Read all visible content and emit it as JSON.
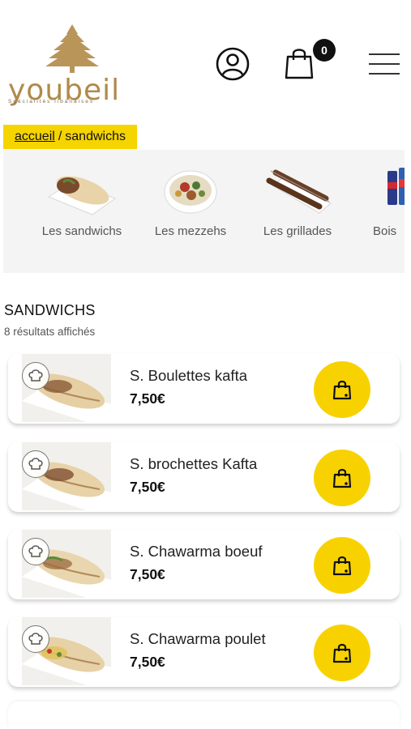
{
  "header": {
    "logo_word": "youbeil",
    "logo_tagline": "Spécialités libanaises",
    "cart_count": "0",
    "icons": {
      "account": "user-icon",
      "cart": "shopping-bag-icon",
      "menu": "hamburger-menu-icon"
    }
  },
  "breadcrumb": {
    "home": "accueil",
    "separator": "/",
    "current": "sandwichs"
  },
  "categories": [
    {
      "label": "Les sandwichs",
      "icon": "sandwich-image"
    },
    {
      "label": "Les mezzehs",
      "icon": "mezze-bowl-image"
    },
    {
      "label": "Les grillades",
      "icon": "skewers-image"
    },
    {
      "label": "Bois",
      "icon": "drinks-cans-image"
    }
  ],
  "section": {
    "title": "SANDWICHS",
    "results": "8 résultats affichés"
  },
  "products": [
    {
      "name": "S. Boulettes kafta",
      "price": "7,50€"
    },
    {
      "name": "S. brochettes Kafta",
      "price": "7,50€"
    },
    {
      "name": "S. Chawarma boeuf",
      "price": "7,50€"
    },
    {
      "name": "S. Chawarma poulet",
      "price": "7,50€"
    }
  ],
  "colors": {
    "accent": "#f8d200",
    "breadcrumb_bg": "#f5d400",
    "logo_gold": "#b08a4a"
  }
}
